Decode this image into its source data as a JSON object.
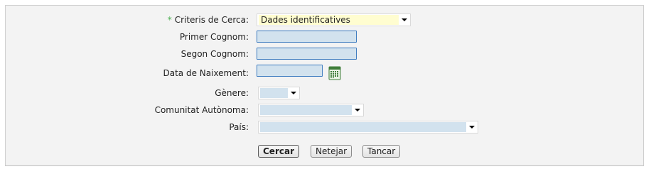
{
  "form": {
    "criteris": {
      "label": "Criteris de Cerca:",
      "required_mark": "*",
      "value": "Dades identificatives"
    },
    "primer_cognom": {
      "label": "Primer Cognom:",
      "value": ""
    },
    "segon_cognom": {
      "label": "Segon Cognom:",
      "value": ""
    },
    "data_naixement": {
      "label": "Data de Naixement:",
      "value": ""
    },
    "genere": {
      "label": "Gènere:",
      "value": ""
    },
    "comunitat": {
      "label": "Comunitat Autònoma:",
      "value": ""
    },
    "pais": {
      "label": "País:",
      "value": ""
    }
  },
  "buttons": {
    "cercar": "Cercar",
    "netejar": "Netejar",
    "tancar": "Tancar"
  },
  "icons": {
    "calendar": "calendar-icon",
    "dropdown": "chevron-down-icon"
  },
  "colors": {
    "input_bg": "#d2e2ee",
    "input_border": "#3b7abf",
    "highlight": "#fffdd0",
    "required": "#4caf50"
  }
}
